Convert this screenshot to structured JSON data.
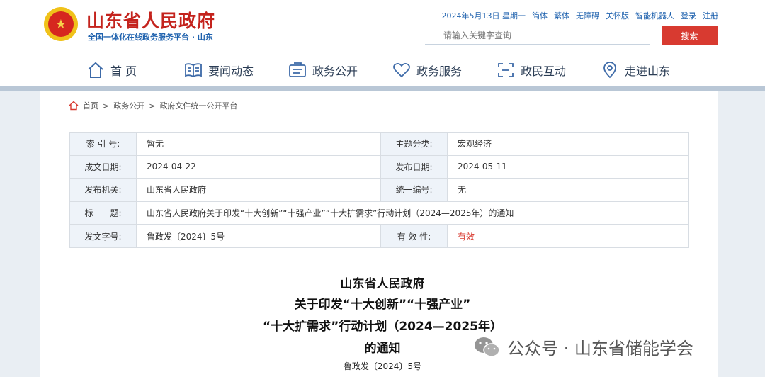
{
  "header": {
    "site_title": "山东省人民政府",
    "site_subtitle": "全国一体化在线政务服务平台 · 山东",
    "emblem_glyph": "★",
    "date": "2024年5月13日 星期一",
    "links": [
      "简体",
      "繁体",
      "无障碍",
      "关怀版",
      "智能机器人",
      "登录",
      "注册"
    ],
    "search_placeholder": "请输入关键字查询",
    "search_button": "搜索"
  },
  "nav": [
    {
      "label": "首 页",
      "icon": "home-icon"
    },
    {
      "label": "要闻动态",
      "icon": "book-icon"
    },
    {
      "label": "政务公开",
      "icon": "document-icon"
    },
    {
      "label": "政务服务",
      "icon": "heart-icon"
    },
    {
      "label": "政民互动",
      "icon": "interaction-icon"
    },
    {
      "label": "走进山东",
      "icon": "location-icon"
    }
  ],
  "breadcrumb": [
    "首页",
    "政务公开",
    "政府文件统一公开平台"
  ],
  "meta": {
    "index_label": "索 引 号:",
    "index_value": "暂无",
    "topic_label": "主题分类:",
    "topic_value": "宏观经济",
    "written_label": "成文日期:",
    "written_value": "2024-04-22",
    "published_label": "发布日期:",
    "published_value": "2024-05-11",
    "issuer_label": "发布机关:",
    "issuer_value": "山东省人民政府",
    "serial_label": "统一编号:",
    "serial_value": "无",
    "title_label": "标　　题:",
    "title_value": "山东省人民政府关于印发“十大创新”“十强产业”“十大扩需求”行动计划（2024—2025年）的通知",
    "docno_label": "发文字号:",
    "docno_value": "鲁政发〔2024〕5号",
    "validity_label": "有 效 性:",
    "validity_value": "有效"
  },
  "document": {
    "title_lines": [
      "山东省人民政府",
      "关于印发“十大创新”“十强产业”",
      "“十大扩需求”行动计划（2024—2025年）",
      "的通知"
    ],
    "doc_number": "鲁政发〔2024〕5号"
  },
  "watermark": {
    "text": "公众号 · 山东省储能学会"
  },
  "colors": {
    "brand_red": "#c4231d",
    "link_blue": "#1f62ae",
    "button_red": "#d83a30"
  }
}
